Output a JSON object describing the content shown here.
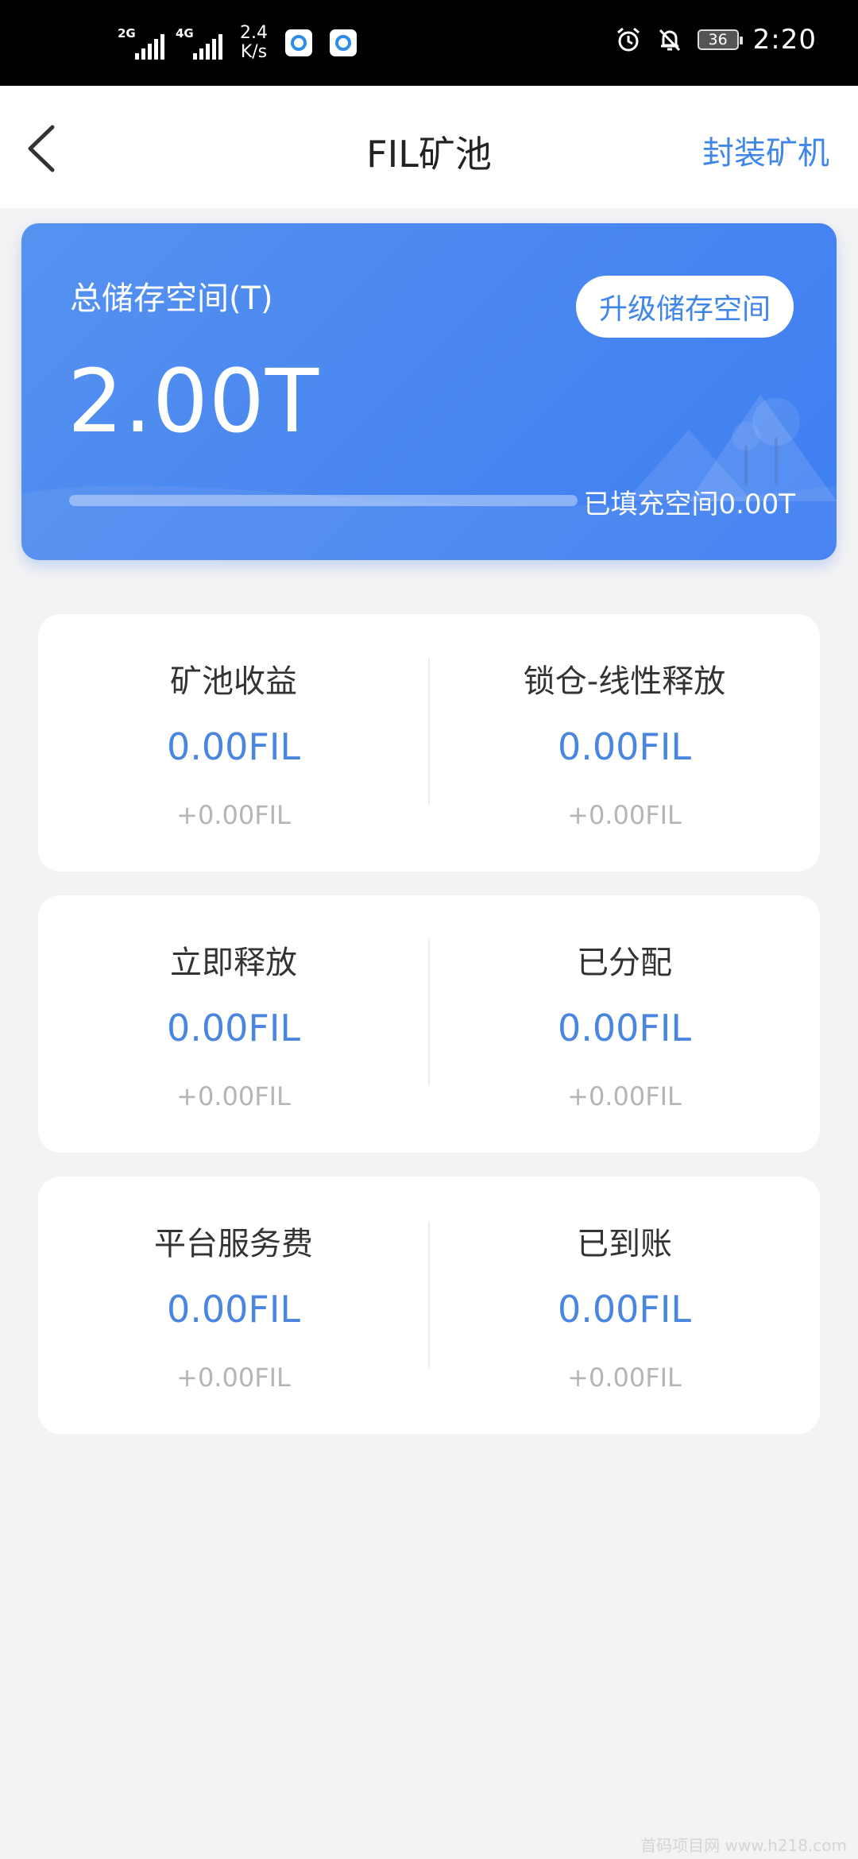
{
  "status_bar": {
    "net1": "2G",
    "net2": "4G",
    "speed_value": "2.4",
    "speed_unit": "K/s",
    "battery": "36",
    "time": "2:20"
  },
  "nav": {
    "title": "FIL矿池",
    "action": "封装矿机"
  },
  "storage": {
    "label": "总储存空间(T)",
    "value": "2.00T",
    "upgrade_label": "升级储存空间",
    "filled_label": "已填充空间0.00T",
    "filled_fraction": 0
  },
  "stats": [
    {
      "left": {
        "label": "矿池收益",
        "amount": "0.00FIL",
        "delta": "+0.00FIL"
      },
      "right": {
        "label": "锁仓-线性释放",
        "amount": "0.00FIL",
        "delta": "+0.00FIL"
      }
    },
    {
      "left": {
        "label": "立即释放",
        "amount": "0.00FIL",
        "delta": "+0.00FIL"
      },
      "right": {
        "label": "已分配",
        "amount": "0.00FIL",
        "delta": "+0.00FIL"
      }
    },
    {
      "left": {
        "label": "平台服务费",
        "amount": "0.00FIL",
        "delta": "+0.00FIL"
      },
      "right": {
        "label": "已到账",
        "amount": "0.00FIL",
        "delta": "+0.00FIL"
      }
    }
  ],
  "watermark": "首码项目网 www.h218.com",
  "colors": {
    "accent": "#3f86e8",
    "amount": "#4a86df",
    "card_gradient_start": "#5592f0",
    "card_gradient_end": "#3d7ef2",
    "background": "#f3f3f4"
  }
}
